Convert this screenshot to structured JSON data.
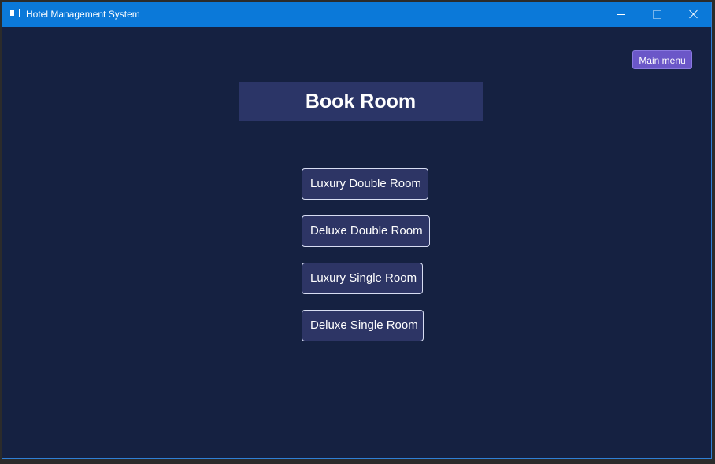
{
  "window": {
    "title": "Hotel Management System",
    "controls": [
      "minimize",
      "maximize",
      "close"
    ]
  },
  "toolbar": {
    "main_menu_label": "Main menu"
  },
  "page": {
    "heading": "Book Room",
    "room_options": [
      "Luxury Double Room",
      "Deluxe Double Room",
      "Luxury Single Room",
      "Deluxe Single Room"
    ]
  },
  "colors": {
    "titlebar": "#0b79d9",
    "background": "#152141",
    "heading_panel": "#2b3567",
    "button_background": "#2d3565",
    "main_menu_button": "#6b57c8",
    "text": "#ffffff"
  },
  "icons": {
    "app": "window-app-icon",
    "minimize": "minimize-icon",
    "maximize": "maximize-icon",
    "close": "close-icon"
  }
}
